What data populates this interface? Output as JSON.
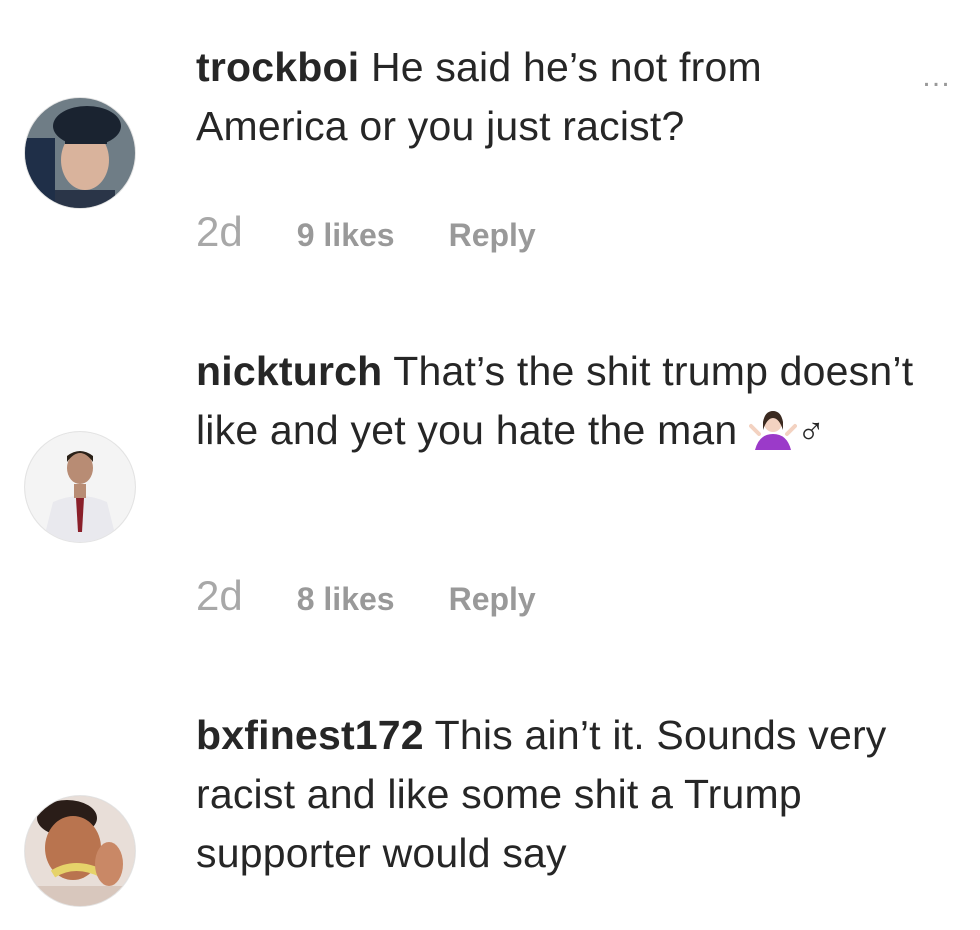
{
  "comments": [
    {
      "username": "trockboi",
      "text": "He said he’s not from America or you just racist?",
      "time": "2d",
      "likes": "9 likes",
      "reply": "Reply",
      "more": "…"
    },
    {
      "username": "nickturch",
      "text": "That’s the shit trump doesn’t like and yet you hate the man",
      "emoji": "shrug",
      "male_sign": "♂",
      "time": "2d",
      "likes": "8 likes",
      "reply": "Reply"
    },
    {
      "username": "bxfinest172",
      "text": "This ain’t it. Sounds very racist and like some shit a Trump supporter would say"
    }
  ],
  "colors": {
    "username": "#262626",
    "meta": "#999999",
    "accent_shrug": "#9b3ac9"
  }
}
